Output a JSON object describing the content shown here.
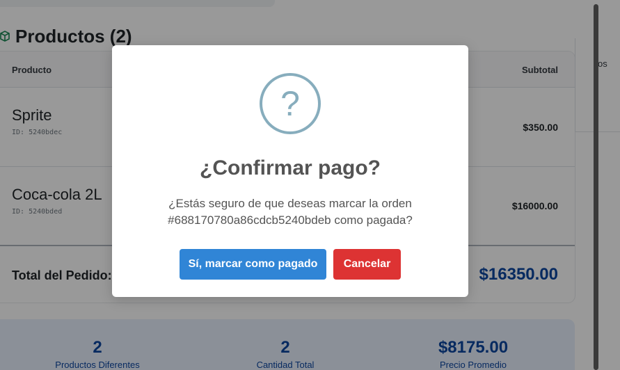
{
  "products_section": {
    "title": "Productos (2)",
    "icon": "box-icon"
  },
  "table": {
    "headers": {
      "product": "Producto",
      "subtotal": "Subtotal"
    },
    "rows": [
      {
        "name": "Sprite",
        "id": "ID: 5240bdec",
        "subtotal": "$350.00"
      },
      {
        "name": "Coca-cola 2L",
        "id": "ID: 5240bded",
        "subtotal": "$16000.00"
      }
    ],
    "total_label": "Total del Pedido:",
    "total_value": "$16350.00"
  },
  "stats": [
    {
      "value": "2",
      "label": "Productos Diferentes"
    },
    {
      "value": "2",
      "label": "Cantidad Total"
    },
    {
      "value": "$8175.00",
      "label": "Precio Promedio"
    }
  ],
  "side_panel": {
    "text": "os"
  },
  "modal": {
    "icon": "question-icon",
    "icon_glyph": "?",
    "title": "¿Confirmar pago?",
    "text": "¿Estás seguro de que deseas marcar la orden #688170780a86cdcb5240bdeb como pagada?",
    "confirm_label": "Sí, marcar como pagado",
    "cancel_label": "Cancelar"
  },
  "colors": {
    "confirm": "#3085d6",
    "cancel": "#dd3333",
    "accent_blue": "#0d47a1",
    "question_icon": "#87adbd"
  }
}
